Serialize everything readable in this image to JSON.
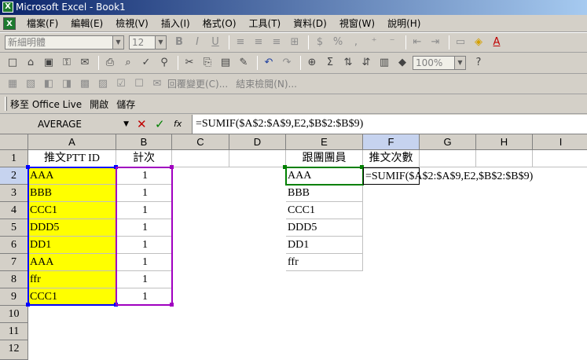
{
  "window": {
    "title": "Microsoft Excel - Book1",
    "app_icon": "X"
  },
  "menu": [
    "檔案(F)",
    "編輯(E)",
    "檢視(V)",
    "插入(I)",
    "格式(O)",
    "工具(T)",
    "資料(D)",
    "視窗(W)",
    "說明(H)"
  ],
  "format_toolbar": {
    "font_name": "新細明體",
    "font_size": "12",
    "bold": "B",
    "italic": "I",
    "underline": "U",
    "currency": "$",
    "percent": "%"
  },
  "standard_toolbar": {
    "zoom": "100%",
    "sigma": "Σ"
  },
  "review_toolbar": {
    "reply_changes": "回覆變更(C)...",
    "end_review": "結束檢閱(N)..."
  },
  "office_live_toolbar": {
    "goto_office_live": "移至 Office Live",
    "open": "開啟",
    "save": "儲存"
  },
  "formula_bar": {
    "name_box": "AVERAGE",
    "fx": "fx",
    "formula": "=SUMIF($A$2:$A$9,E2,$B$2:$B$9)"
  },
  "columns": [
    "A",
    "B",
    "C",
    "D",
    "E",
    "F",
    "G",
    "H",
    "I"
  ],
  "rows": [
    "1",
    "2",
    "3",
    "4",
    "5",
    "6",
    "7",
    "8",
    "9",
    "10",
    "11",
    "12"
  ],
  "cells": {
    "A1": "推文PTT ID",
    "B1": "計次",
    "E1": "跟團團員",
    "F1": "推文次數",
    "A2": "AAA",
    "B2": "1",
    "E2": "AAA",
    "F2": "=SUMIF($A$2:$A$9,E2,$B$2:$B$9)",
    "A3": "BBB",
    "B3": "1",
    "E3": "BBB",
    "A4": "CCC1",
    "B4": "1",
    "E4": "CCC1",
    "A5": "DDD5",
    "B5": "1",
    "E5": "DDD5",
    "A6": "DD1",
    "B6": "1",
    "E6": "DD1",
    "A7": "AAA",
    "B7": "1",
    "E7": "ffr",
    "A8": "ffr",
    "B8": "1",
    "A9": "CCC1",
    "B9": "1"
  },
  "colors": {
    "range_a": "#0000ff",
    "range_b": "#a000c0",
    "range_e": "#008000",
    "highlight": "#ffff00"
  }
}
